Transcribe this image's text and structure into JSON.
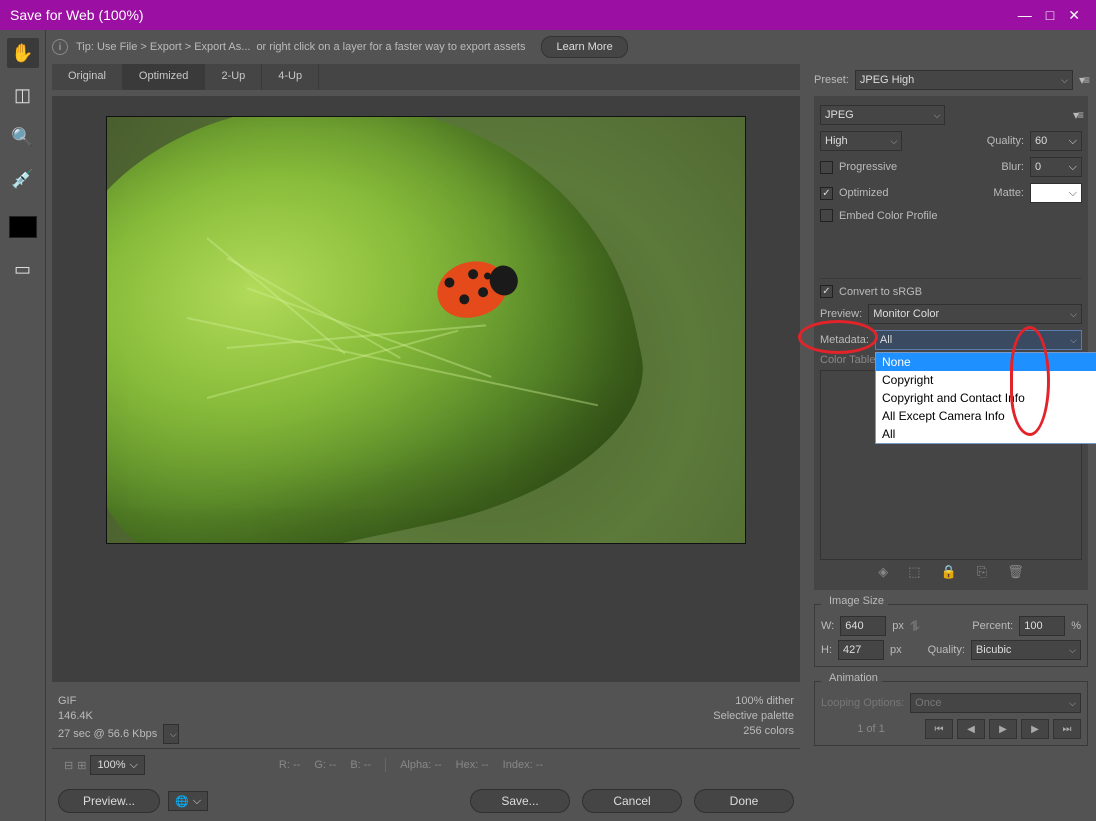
{
  "title": "Save for Web (100%)",
  "tip": {
    "pre": "Tip: Use File > Export > Export As...",
    "post": "or right click on a layer for a faster way to export assets",
    "learn": "Learn More"
  },
  "tabs": [
    "Original",
    "Optimized",
    "2-Up",
    "4-Up"
  ],
  "active_tab": 1,
  "preview_info": {
    "fmt": "GIF",
    "size": "146.4K",
    "time": "27 sec @ 56.6 Kbps",
    "dither": "100% dither",
    "palette": "Selective palette",
    "colors": "256 colors"
  },
  "status": {
    "zoom": "100%",
    "r": "R: --",
    "g": "G: --",
    "b": "B: --",
    "alpha": "Alpha: --",
    "hex": "Hex: --",
    "index": "Index: --"
  },
  "panel": {
    "preset_label": "Preset:",
    "preset": "JPEG High",
    "format": "JPEG",
    "quality_preset": "High",
    "quality_label": "Quality:",
    "quality": "60",
    "progressive": "Progressive",
    "blur_label": "Blur:",
    "blur": "0",
    "optimized": "Optimized",
    "matte_label": "Matte:",
    "embed": "Embed Color Profile",
    "srgb": "Convert to sRGB",
    "preview_label": "Preview:",
    "preview": "Monitor Color",
    "metadata_label": "Metadata:",
    "metadata": "All",
    "metadata_options": [
      "None",
      "Copyright",
      "Copyright and Contact Info",
      "All Except Camera Info",
      "All"
    ],
    "colortable_label": "Color Table",
    "imagesize": {
      "legend": "Image Size",
      "w": "640",
      "h": "427",
      "px": "px",
      "percent_label": "Percent:",
      "percent": "100",
      "pct": "%",
      "quality_label": "Quality:",
      "quality": "Bicubic",
      "w_label": "W:",
      "h_label": "H:"
    },
    "animation": {
      "legend": "Animation",
      "loop_label": "Looping Options:",
      "loop": "Once",
      "page": "1 of 1"
    }
  },
  "footer": {
    "preview": "Preview...",
    "save": "Save...",
    "cancel": "Cancel",
    "done": "Done"
  }
}
